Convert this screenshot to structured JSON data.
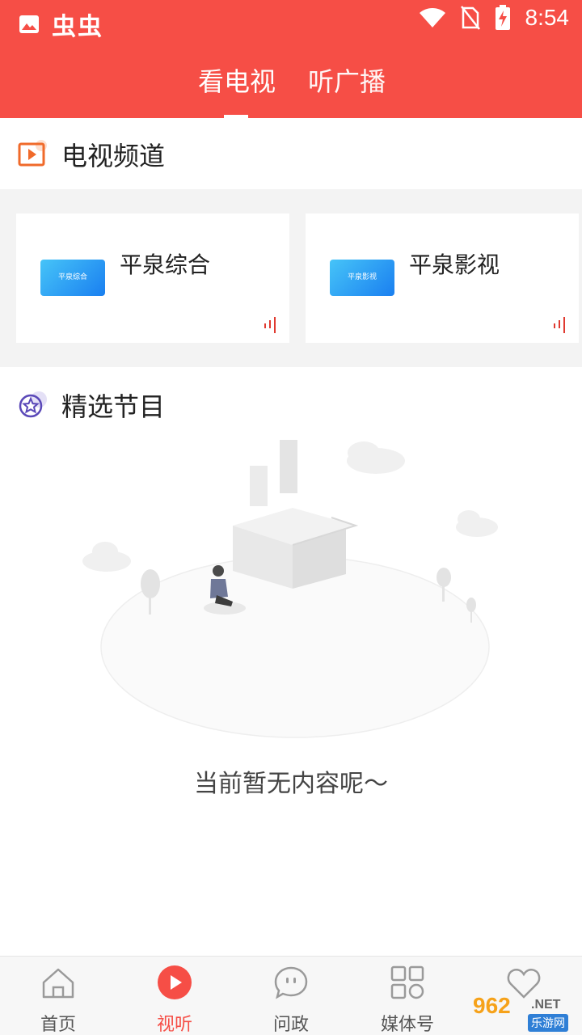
{
  "status_bar": {
    "app_glyphs": "虫虫",
    "time": "8:54"
  },
  "tabs": [
    {
      "label": "看电视",
      "active": true
    },
    {
      "label": "听广播",
      "active": false
    }
  ],
  "tv_section": {
    "title": "电视频道",
    "channels": [
      {
        "name": "平泉综合",
        "logo_text": "平泉综合"
      },
      {
        "name": "平泉影视",
        "logo_text": "平泉影视"
      }
    ]
  },
  "featured_section": {
    "title": "精选节目",
    "empty_text": "当前暂无内容呢～"
  },
  "bottom_nav": [
    {
      "label": "首页",
      "icon": "home-icon",
      "active": false
    },
    {
      "label": "视听",
      "icon": "play-icon",
      "active": true
    },
    {
      "label": "问政",
      "icon": "chat-icon",
      "active": false
    },
    {
      "label": "媒体号",
      "icon": "grid-icon",
      "active": false
    },
    {
      "label": "",
      "icon": "heart-icon",
      "active": false
    }
  ],
  "watermark": {
    "number": "962",
    "domain": ".NET",
    "subtitle": "乐游网"
  },
  "colors": {
    "brand_red": "#f64e46",
    "card_bg": "#ffffff",
    "section_bg": "#f3f3f3"
  }
}
